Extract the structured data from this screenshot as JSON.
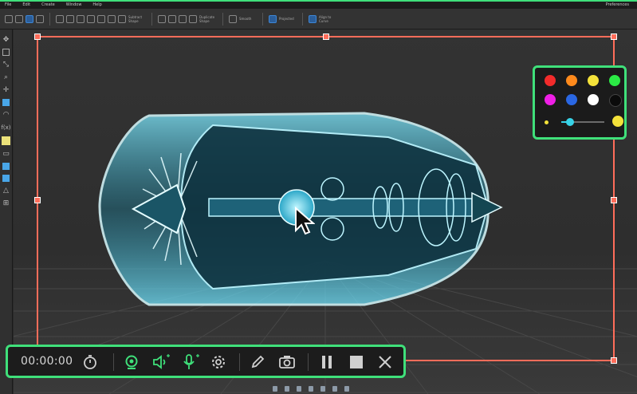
{
  "menubar": {
    "items": [
      "File",
      "Edit",
      "Create",
      "Window",
      "Help"
    ],
    "right_label": "Preferences"
  },
  "toolbar": {
    "labels": [
      "Subtract Shape",
      "Duplicate Shape",
      "Smooth",
      "Projected",
      "Align to Curve"
    ]
  },
  "left_tools": [
    "move",
    "view",
    "select",
    "zoom",
    "pan",
    "shape",
    "arc",
    "f(x)",
    "note",
    "ruler",
    "layer",
    "stack",
    "triangle",
    "grid"
  ],
  "recording": {
    "timer": "00:00:00",
    "buttons": [
      "timer",
      "webcam",
      "system-audio",
      "microphone",
      "settings",
      "draw",
      "screenshot",
      "pause",
      "stop",
      "close"
    ]
  },
  "palette": {
    "colors": [
      "#f22b2b",
      "#ff8a1c",
      "#f4e23a",
      "#2bea45",
      "#ef1fe6",
      "#2a67e3",
      "#ffffff",
      "#0b0b0b"
    ],
    "brush_size": 0.2
  },
  "theme": {
    "accent": "#3fe07a",
    "selection": "#ff6d5a",
    "model": "#58d9f5"
  }
}
